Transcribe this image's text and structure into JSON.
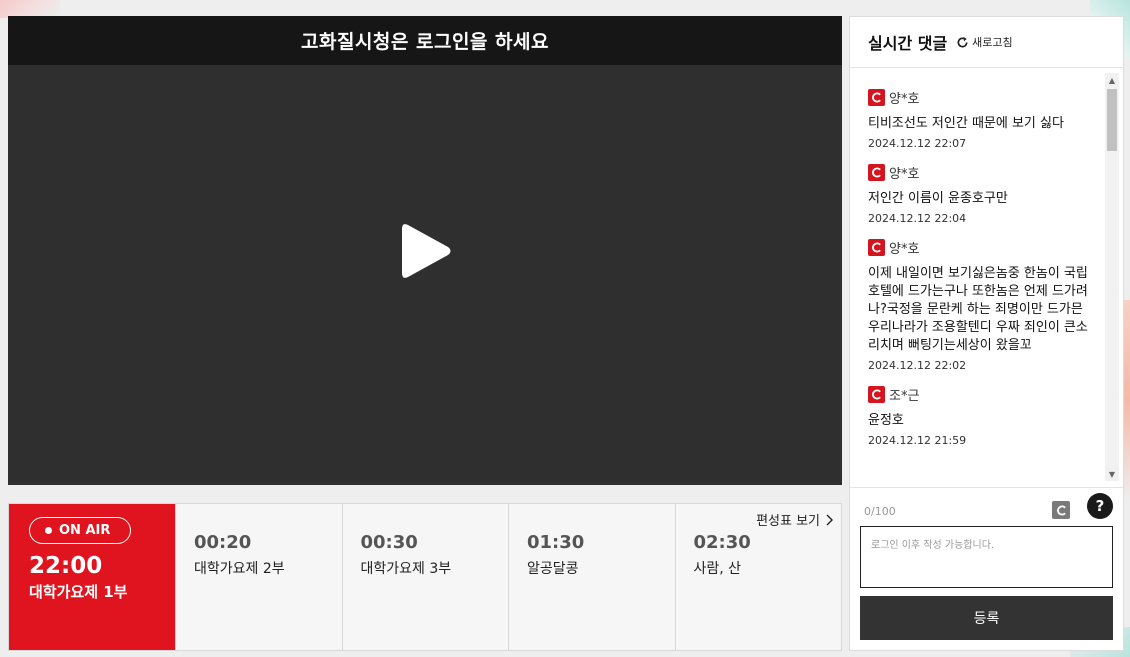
{
  "player": {
    "banner": "고화질시청은 로그인을 하세요",
    "play_icon": "play-icon"
  },
  "schedule": {
    "on_air": {
      "badge": "ON AIR",
      "time": "22:00",
      "title": "대학가요제 1부"
    },
    "slots": [
      {
        "time": "00:20",
        "title": "대학가요제 2부"
      },
      {
        "time": "00:30",
        "title": "대학가요제 3부"
      },
      {
        "time": "01:30",
        "title": "알공달콩"
      },
      {
        "time": "02:30",
        "title": "사람, 산"
      }
    ],
    "link_label": "편성표 보기"
  },
  "comments": {
    "title": "실시간 댓글",
    "refresh_label": "새로고침",
    "items": [
      {
        "user": "양*호",
        "text": "티비조선도 저인간 때문에 보기 싫다",
        "date": "2024.12.12 22:07"
      },
      {
        "user": "양*호",
        "text": "저인간 이름이 윤종호구만",
        "date": "2024.12.12 22:04"
      },
      {
        "user": "양*호",
        "text": "이제 내일이면 보기싫은놈중 한놈이 국립호텔에 드가는구나 또한놈은 언제 드가려나?국정을 문란케 하는 죄명이만 드가믄 우리나라가 조용할텐디 우짜 죄인이 큰소리치며 뻐팅기는세상이 왔을꼬",
        "date": "2024.12.12 22:02"
      },
      {
        "user": "조*근",
        "text": "윤정호",
        "date": "2024.12.12 21:59"
      }
    ],
    "form": {
      "counter": "0/100",
      "help": "?",
      "placeholder": "로그인 이후 작성 가능합니다.",
      "submit_label": "등록"
    }
  },
  "colors": {
    "accent_red": "#e0141e",
    "banner_bg": "#161616",
    "player_bg": "#2f2f2f",
    "button_dark": "#333333"
  }
}
